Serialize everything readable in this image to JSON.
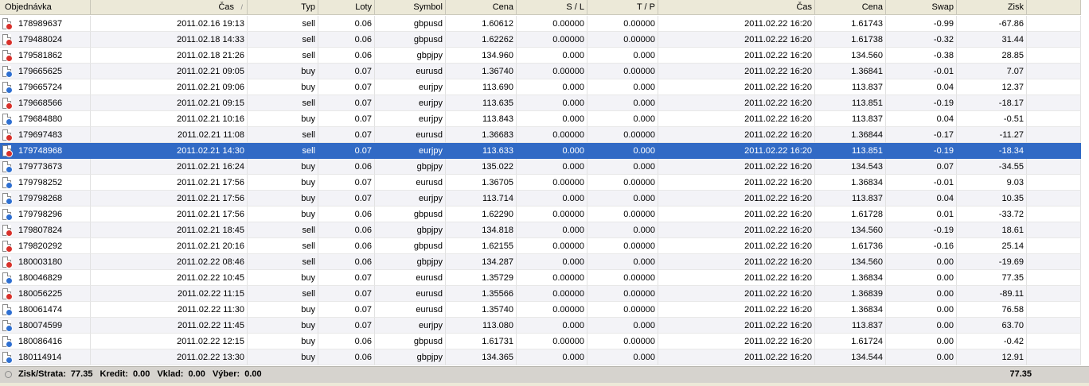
{
  "columns": [
    "Objednávka",
    "Čas",
    "Typ",
    "Loty",
    "Symbol",
    "Cena",
    "S / L",
    "T / P",
    "Čas",
    "Cena",
    "Swap",
    "Zisk",
    ""
  ],
  "sort_indicator": "/",
  "rows": [
    [
      "178989637",
      "2011.02.16 19:13",
      "sell",
      "0.06",
      "gbpusd",
      "1.60612",
      "0.00000",
      "0.00000",
      "2011.02.22 16:20",
      "1.61743",
      "-0.99",
      "-67.86"
    ],
    [
      "179488024",
      "2011.02.18 14:33",
      "sell",
      "0.06",
      "gbpusd",
      "1.62262",
      "0.00000",
      "0.00000",
      "2011.02.22 16:20",
      "1.61738",
      "-0.32",
      "31.44"
    ],
    [
      "179581862",
      "2011.02.18 21:26",
      "sell",
      "0.06",
      "gbpjpy",
      "134.960",
      "0.000",
      "0.000",
      "2011.02.22 16:20",
      "134.560",
      "-0.38",
      "28.85"
    ],
    [
      "179665625",
      "2011.02.21 09:05",
      "buy",
      "0.07",
      "eurusd",
      "1.36740",
      "0.00000",
      "0.00000",
      "2011.02.22 16:20",
      "1.36841",
      "-0.01",
      "7.07"
    ],
    [
      "179665724",
      "2011.02.21 09:06",
      "buy",
      "0.07",
      "eurjpy",
      "113.690",
      "0.000",
      "0.000",
      "2011.02.22 16:20",
      "113.837",
      "0.04",
      "12.37"
    ],
    [
      "179668566",
      "2011.02.21 09:15",
      "sell",
      "0.07",
      "eurjpy",
      "113.635",
      "0.000",
      "0.000",
      "2011.02.22 16:20",
      "113.851",
      "-0.19",
      "-18.17"
    ],
    [
      "179684880",
      "2011.02.21 10:16",
      "buy",
      "0.07",
      "eurjpy",
      "113.843",
      "0.000",
      "0.000",
      "2011.02.22 16:20",
      "113.837",
      "0.04",
      "-0.51"
    ],
    [
      "179697483",
      "2011.02.21 11:08",
      "sell",
      "0.07",
      "eurusd",
      "1.36683",
      "0.00000",
      "0.00000",
      "2011.02.22 16:20",
      "1.36844",
      "-0.17",
      "-11.27"
    ],
    [
      "179748968",
      "2011.02.21 14:30",
      "sell",
      "0.07",
      "eurjpy",
      "113.633",
      "0.000",
      "0.000",
      "2011.02.22 16:20",
      "113.851",
      "-0.19",
      "-18.34"
    ],
    [
      "179773673",
      "2011.02.21 16:24",
      "buy",
      "0.06",
      "gbpjpy",
      "135.022",
      "0.000",
      "0.000",
      "2011.02.22 16:20",
      "134.543",
      "0.07",
      "-34.55"
    ],
    [
      "179798252",
      "2011.02.21 17:56",
      "buy",
      "0.07",
      "eurusd",
      "1.36705",
      "0.00000",
      "0.00000",
      "2011.02.22 16:20",
      "1.36834",
      "-0.01",
      "9.03"
    ],
    [
      "179798268",
      "2011.02.21 17:56",
      "buy",
      "0.07",
      "eurjpy",
      "113.714",
      "0.000",
      "0.000",
      "2011.02.22 16:20",
      "113.837",
      "0.04",
      "10.35"
    ],
    [
      "179798296",
      "2011.02.21 17:56",
      "buy",
      "0.06",
      "gbpusd",
      "1.62290",
      "0.00000",
      "0.00000",
      "2011.02.22 16:20",
      "1.61728",
      "0.01",
      "-33.72"
    ],
    [
      "179807824",
      "2011.02.21 18:45",
      "sell",
      "0.06",
      "gbpjpy",
      "134.818",
      "0.000",
      "0.000",
      "2011.02.22 16:20",
      "134.560",
      "-0.19",
      "18.61"
    ],
    [
      "179820292",
      "2011.02.21 20:16",
      "sell",
      "0.06",
      "gbpusd",
      "1.62155",
      "0.00000",
      "0.00000",
      "2011.02.22 16:20",
      "1.61736",
      "-0.16",
      "25.14"
    ],
    [
      "180003180",
      "2011.02.22 08:46",
      "sell",
      "0.06",
      "gbpjpy",
      "134.287",
      "0.000",
      "0.000",
      "2011.02.22 16:20",
      "134.560",
      "0.00",
      "-19.69"
    ],
    [
      "180046829",
      "2011.02.22 10:45",
      "buy",
      "0.07",
      "eurusd",
      "1.35729",
      "0.00000",
      "0.00000",
      "2011.02.22 16:20",
      "1.36834",
      "0.00",
      "77.35"
    ],
    [
      "180056225",
      "2011.02.22 11:15",
      "sell",
      "0.07",
      "eurusd",
      "1.35566",
      "0.00000",
      "0.00000",
      "2011.02.22 16:20",
      "1.36839",
      "0.00",
      "-89.11"
    ],
    [
      "180061474",
      "2011.02.22 11:30",
      "buy",
      "0.07",
      "eurusd",
      "1.35740",
      "0.00000",
      "0.00000",
      "2011.02.22 16:20",
      "1.36834",
      "0.00",
      "76.58"
    ],
    [
      "180074599",
      "2011.02.22 11:45",
      "buy",
      "0.07",
      "eurjpy",
      "113.080",
      "0.000",
      "0.000",
      "2011.02.22 16:20",
      "113.837",
      "0.00",
      "63.70"
    ],
    [
      "180086416",
      "2011.02.22 12:15",
      "buy",
      "0.06",
      "gbpusd",
      "1.61731",
      "0.00000",
      "0.00000",
      "2011.02.22 16:20",
      "1.61724",
      "0.00",
      "-0.42"
    ],
    [
      "180114914",
      "2011.02.22 13:30",
      "buy",
      "0.06",
      "gbpjpy",
      "134.365",
      "0.000",
      "0.000",
      "2011.02.22 16:20",
      "134.544",
      "0.00",
      "12.91"
    ]
  ],
  "selected_row": 8,
  "status": {
    "profit_label": "Zisk/Strata:",
    "profit_value": "77.35",
    "credit_label": "Kredit:",
    "credit_value": "0.00",
    "deposit_label": "Vklad:",
    "deposit_value": "0.00",
    "withdrawal_label": "Výber:",
    "withdrawal_value": "0.00",
    "total": "77.35"
  },
  "colors": {
    "selection": "#316ac5",
    "sell_marker": "#d8302a",
    "buy_marker": "#2e6fd1"
  }
}
